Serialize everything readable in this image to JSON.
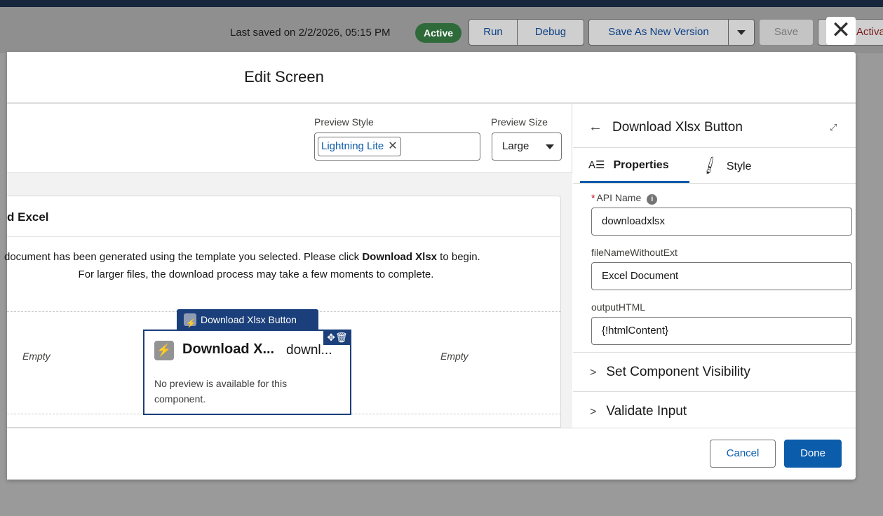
{
  "toolbar": {
    "last_saved": "Last saved on 2/2/2026, 05:15 PM",
    "status_badge": "Active",
    "run_label": "Run",
    "debug_label": "Debug",
    "save_as_new_version_label": "Save As New Version",
    "save_label": "Save",
    "activate_label": "Activat"
  },
  "modal": {
    "title": "Edit Screen",
    "close_glyph": "✕",
    "preview_style": {
      "label": "Preview Style",
      "value": "Lightning Lite"
    },
    "preview_size": {
      "label": "Preview Size",
      "value": "Large"
    },
    "card": {
      "title": "d Excel",
      "message_line1_pre": "document has been generated using the template you selected. Please click ",
      "message_line1_bold": "Download Xlsx",
      "message_line1_post": " to begin.",
      "message_line2": "For larger files, the download process may take a few moments to complete.",
      "empty_left": "Empty",
      "empty_right": "Empty",
      "component": {
        "tag_label": "Download Xlsx Button",
        "name": "Download X...",
        "api_preview": "downl...",
        "note": "No preview is available for this component."
      }
    },
    "properties_panel": {
      "title": "Download Xlsx Button",
      "tabs": {
        "properties": "Properties",
        "style": "Style"
      },
      "fields": {
        "api_name": {
          "label": "API Name",
          "value": "downloadxlsx"
        },
        "file_name": {
          "label": "fileNameWithoutExt",
          "value": "Excel Document"
        },
        "output_html": {
          "label": "outputHTML",
          "value": "{!htmlContent}"
        }
      },
      "sections": {
        "visibility": "Set Component Visibility",
        "validate": "Validate Input"
      }
    },
    "footer": {
      "cancel_label": "Cancel",
      "done_label": "Done"
    }
  },
  "colors": {
    "brand": "#0b5cab",
    "active_badge": "#2e6a3a",
    "component_frame": "#1b3f7a"
  }
}
